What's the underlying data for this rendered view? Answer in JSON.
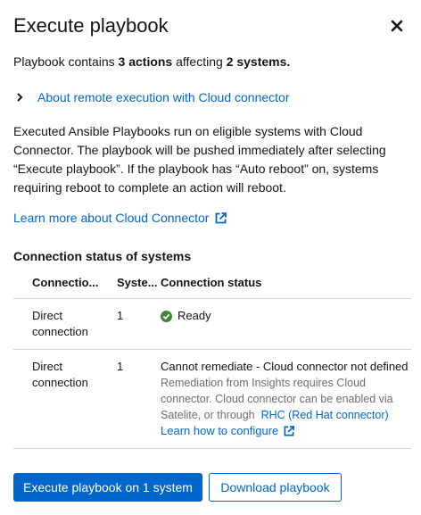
{
  "modal": {
    "title": "Execute playbook",
    "close_icon": "close-icon"
  },
  "summary": {
    "prefix": "Playbook contains ",
    "actions": "3 actions",
    "middle": " affecting ",
    "systems": "2 systems."
  },
  "expandable": {
    "label": "About remote execution with Cloud connector",
    "icon": "chevron-right-icon"
  },
  "description": "Executed Ansible Playbooks run on eligible systems with Cloud Connector. The playbook will be pushed immediately after selecting “Execute playbook”. If the playbook has “Auto reboot” on, systems requiring reboot to complete an action will reboot.",
  "learn_more": {
    "label": "Learn more about Cloud Connector",
    "icon": "external-link-icon"
  },
  "connection_section": {
    "heading": "Connection status of systems",
    "columns": [
      "Connectio...",
      "Syste...",
      "Connection status"
    ],
    "rows": [
      {
        "connection": "Direct connection",
        "systems": "1",
        "status": "Ready",
        "status_icon": "check-circle-icon"
      },
      {
        "connection": "Direct connection",
        "systems": "1",
        "status": "Cannot remediate - Cloud connector not defined",
        "detail": "Remediation from Insights requires Cloud connector. Cloud connector can be enabled via Satelite, or through",
        "detail_link": "RHC (Red Hat connector)",
        "configure_link": "Learn how to configure",
        "configure_icon": "external-link-icon"
      }
    ]
  },
  "footer": {
    "primary_label": "Execute playbook on 1 system",
    "secondary_label": "Download playbook"
  },
  "colors": {
    "link": "#0066cc",
    "success": "#3e8635",
    "border": "#d2d2d2",
    "muted": "#6a6e73"
  }
}
